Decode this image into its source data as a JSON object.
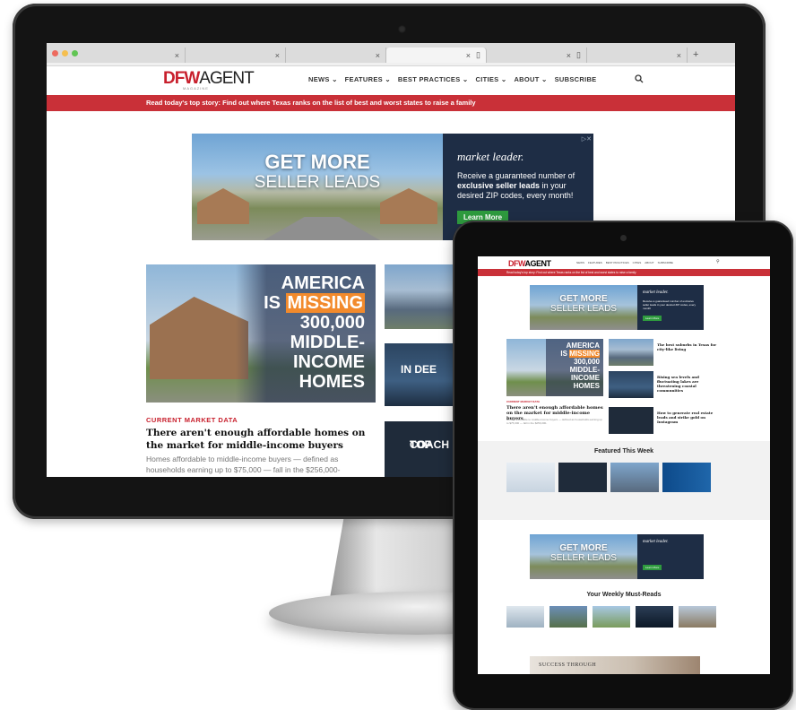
{
  "browser": {
    "tabs": [
      {
        "close": "×"
      },
      {
        "close": "×"
      },
      {
        "close": "×"
      },
      {
        "close": "×"
      },
      {
        "close": "×"
      },
      {
        "close": "×"
      }
    ],
    "new_tab": "+",
    "traffic_colors": [
      "#ed6a5e",
      "#f5bf4f",
      "#61c554"
    ]
  },
  "site": {
    "logo_dfw": "DFW",
    "logo_agent": "AGENT",
    "logo_sub": "MAGAZINE",
    "nav": [
      "NEWS",
      "FEATURES",
      "BEST PRACTICES",
      "CITIES",
      "ABOUT",
      "SUBSCRIBE"
    ],
    "banner": "Read today's top story: Find out where Texas ranks on the list of best and worst states to raise a family",
    "accent": "#c8202d"
  },
  "ad": {
    "headline1": "GET MORE",
    "headline2": "SELLER LEADS",
    "brand": "market leader.",
    "copy_before": "Receive a guaranteed number of ",
    "copy_bold": "exclusive seller leads",
    "copy_after": " in your desired ZIP codes, every month!",
    "cta": "Learn More"
  },
  "feature": {
    "image_lines": [
      "AMERICA",
      "IS",
      "MISSING",
      "300,000",
      "MIDDLE-",
      "INCOME",
      "HOMES"
    ],
    "category": "CURRENT MARKET DATA",
    "title": "There aren't enough affordable homes on the market for middle-income buyers",
    "body": "Homes affordable to middle-income buyers — defined as households earning up to $75,000 — fall in the $256,000-"
  },
  "side_thumbs": {
    "in_deep": "IN DEE",
    "top_coach": [
      "TOP",
      "COACH"
    ]
  },
  "tablet": {
    "featured_heading": "Featured This Week",
    "weekly_heading": "Your Weekly Must-Reads",
    "right_stories": [
      {
        "title": "The best suburbs in Texas for city-like living"
      },
      {
        "title": "Rising sea levels and fluctuating lakes are threatening coastal communities"
      },
      {
        "title": "How to generate real estate leads and strike gold on Instagram"
      }
    ],
    "success_text": "SUCCESS THROUGH"
  }
}
